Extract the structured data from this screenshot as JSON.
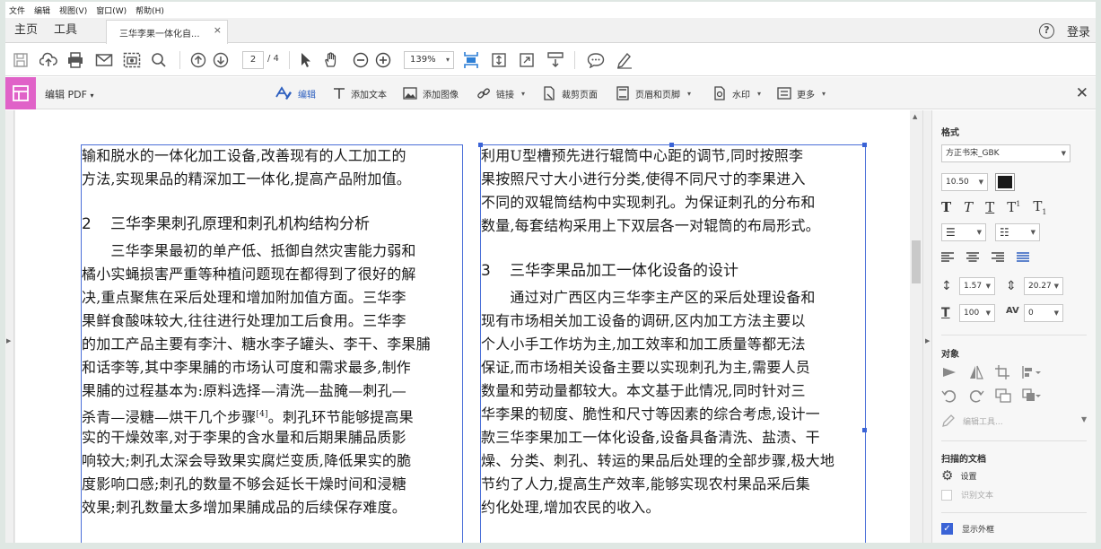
{
  "menu": [
    "文件",
    "编辑",
    "视图(V)",
    "窗口(W)",
    "帮助(H)"
  ],
  "tabs": {
    "home": "主页",
    "tools": "工具",
    "doc": "三华李果一体化自...",
    "close": "×",
    "help": "?",
    "login": "登录"
  },
  "toolbar": {
    "page_current": "2",
    "page_total": "/ 4",
    "zoom": "139%",
    "dropdown": "▾"
  },
  "editbar": {
    "title": "编辑 PDF",
    "title_caret": "▾",
    "items": [
      "编辑",
      "添加文本",
      "添加图像",
      "链接",
      "裁剪页面",
      "页眉和页脚",
      "水印",
      "更多"
    ],
    "caret": "▾",
    "close": "✕"
  },
  "document": {
    "col1": [
      "输和脱水的一体化加工设备,改善现有的人工加工的",
      "方法,实现果品的精深加工一体化,提高产品附加值。",
      "",
      "#2|三华李果刺孔原理和刺孔机构结构分析",
      "　　三华李果最初的单产低、抵御自然灾害能力弱和",
      "橘小实蝇损害严重等种植问题现在都得到了很好的解",
      "决,重点聚焦在采后处理和增加附加值方面。三华李",
      "果鲜食酸味较大,往往进行处理加工后食用。三华李",
      "的加工产品主要有李汁、糖水李子罐头、李干、李果脯",
      "和话李等,其中李果脯的市场认可度和需求最多,制作",
      "果脯的过程基本为:原料选择—清洗—盐腌—刺孔—",
      "杀青—浸糖—烘干几个步骤[4]。刺孔环节能够提高果",
      "实的干燥效率,对于李果的含水量和后期果脯品质影",
      "响较大;刺孔太深会导致果实腐烂变质,降低果实的脆",
      "度影响口感;刺孔的数量不够会延长干燥时间和浸糖",
      "效果;刺孔数量太多增加果脯成品的后续保存难度。"
    ],
    "col2": [
      "利用U型槽预先进行辊筒中心距的调节,同时按照李",
      "果按照尺寸大小进行分类,使得不同尺寸的李果进入",
      "不同的双辊筒结构中实现刺孔。为保证刺孔的分布和",
      "数量,每套结构采用上下双层各一对辊筒的布局形式。",
      "",
      "#3|三华李果品加工一体化设备的设计",
      "　　通过对广西区内三华李主产区的采后处理设备和",
      "现有市场相关加工设备的调研,区内加工方法主要以",
      "个人小手工作坊为主,加工效率和加工质量等都无法",
      "保证,而市场相关设备主要以实现刺孔为主,需要人员",
      "数量和劳动量都较大。本文基于此情况,同时针对三",
      "华李果的韧度、脆性和尺寸等因素的综合考虑,设计一",
      "款三华李果加工一体化设备,设备具备清洗、盐渍、干",
      "燥、分类、刺孔、转运的果品后处理的全部步骤,极大地",
      "节约了人力,提高生产效率,能够实现农村果品采后集",
      "约化处理,增加农民的收入。"
    ]
  },
  "panel": {
    "format_title": "格式",
    "font_name": "方正书宋_GBK",
    "font_size": "10.50",
    "text_color": "#1a1a1a",
    "line_spacing": "1.57",
    "para_spacing": "20.27",
    "h_scale": "100",
    "char_spacing": "0",
    "object_title": "对象",
    "edit_tool": "编辑工具...",
    "scanned_title": "扫描的文档",
    "settings": "设置",
    "recognize_text": "识别文本",
    "show_bbox": "显示外框",
    "accent": "#3a63d6"
  }
}
